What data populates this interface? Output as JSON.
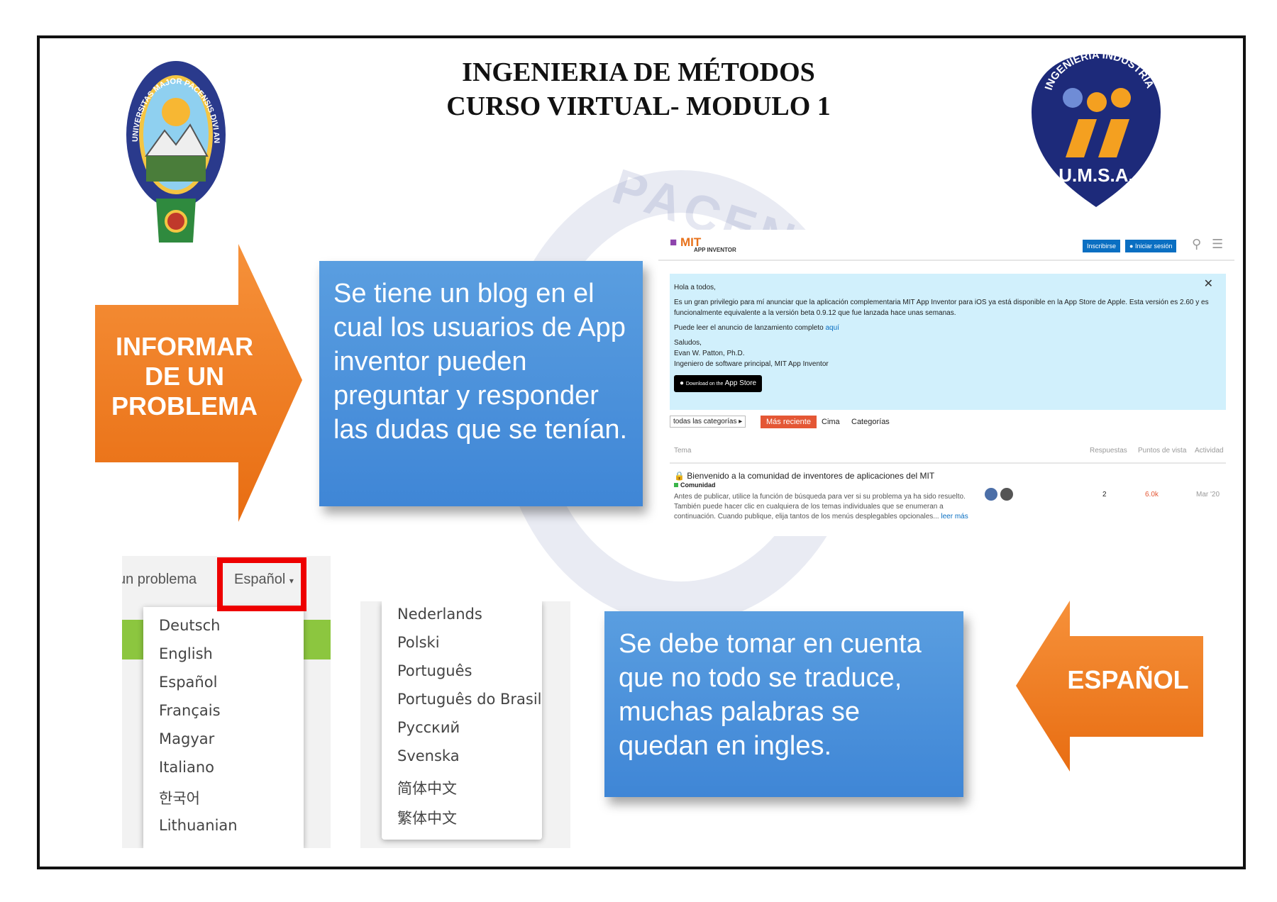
{
  "title": {
    "line1": "INGENIERIA DE MÉTODOS",
    "line2": "CURSO VIRTUAL- MODULO 1"
  },
  "logos": {
    "left_ring": "UNIVERSITAS MAJOR PACENSIS DIVI ANDREAE",
    "right_ring": "INGENIERIA INDUSTRIAL",
    "right_name": "U.M.S.A."
  },
  "arrows": {
    "right": [
      "INFORMAR",
      "DE UN",
      "PROBLEMA"
    ],
    "left": "ESPAÑOL"
  },
  "callouts": {
    "blog": "Se tiene un blog en el cual los usuarios de App inventor pueden preguntar y responder las dudas que se tenían.",
    "translation": "Se debe tomar en cuenta que no todo se traduce, muchas palabras se quedan en ingles."
  },
  "forum": {
    "logo": "MIT",
    "logo_sub": "APP INVENTOR",
    "signup": "Inscribirse",
    "login": "Iniciar sesión",
    "banner": {
      "greeting": "Hola a todos,",
      "body": "Es un gran privilegio para mí anunciar que la aplicación complementaria MIT App Inventor para iOS ya está disponible en la App Store de Apple. Esta versión es 2.60 y es funcionalmente equivalente a la versión beta 0.9.12 que fue lanzada hace unas semanas.",
      "link_prefix": "Puede leer el anuncio de lanzamiento completo",
      "link_text": "aquí",
      "signoff": "Saludos,",
      "name": "Evan W. Patton, Ph.D.",
      "role": "Ingeniero de software principal, MIT App Inventor",
      "appstore_small": "Download on the",
      "appstore": "App Store"
    },
    "filters": {
      "category": "todas las categorías",
      "latest": "Más reciente",
      "top": "Cima",
      "categories": "Categorías"
    },
    "columns": {
      "topic": "Tema",
      "replies": "Respuestas",
      "views": "Puntos de vista",
      "activity": "Actividad"
    },
    "topic": {
      "title": "Bienvenido a la comunidad de inventores de aplicaciones del MIT",
      "category": "Comunidad",
      "excerpt": "Antes de publicar, utilice la función de búsqueda para ver si su problema ya ha sido resuelto. También puede hacer clic en cualquiera de los temas individuales que se enumeran a continuación. Cuando publique, elija tantos de los menús desplegables opcionales...",
      "read_more": "leer más",
      "replies": "2",
      "views": "6.0k",
      "activity": "Mar '20"
    }
  },
  "language_menu": {
    "topbar_left": "un problema",
    "selected": "Español",
    "col1": [
      "Deutsch",
      "English",
      "Español",
      "Français",
      "Magyar",
      "Italiano",
      "한국어",
      "Lithuanian"
    ],
    "col2": [
      "Nederlands",
      "Polski",
      "Português",
      "Português do Brasil",
      "Русский",
      "Svenska",
      "简体中文",
      "繁体中文"
    ]
  },
  "colors": {
    "callout": "#4a90d9",
    "arrow": "#f07f22",
    "forum_accent": "#e45735",
    "forum_banner": "#d1f0fc"
  }
}
